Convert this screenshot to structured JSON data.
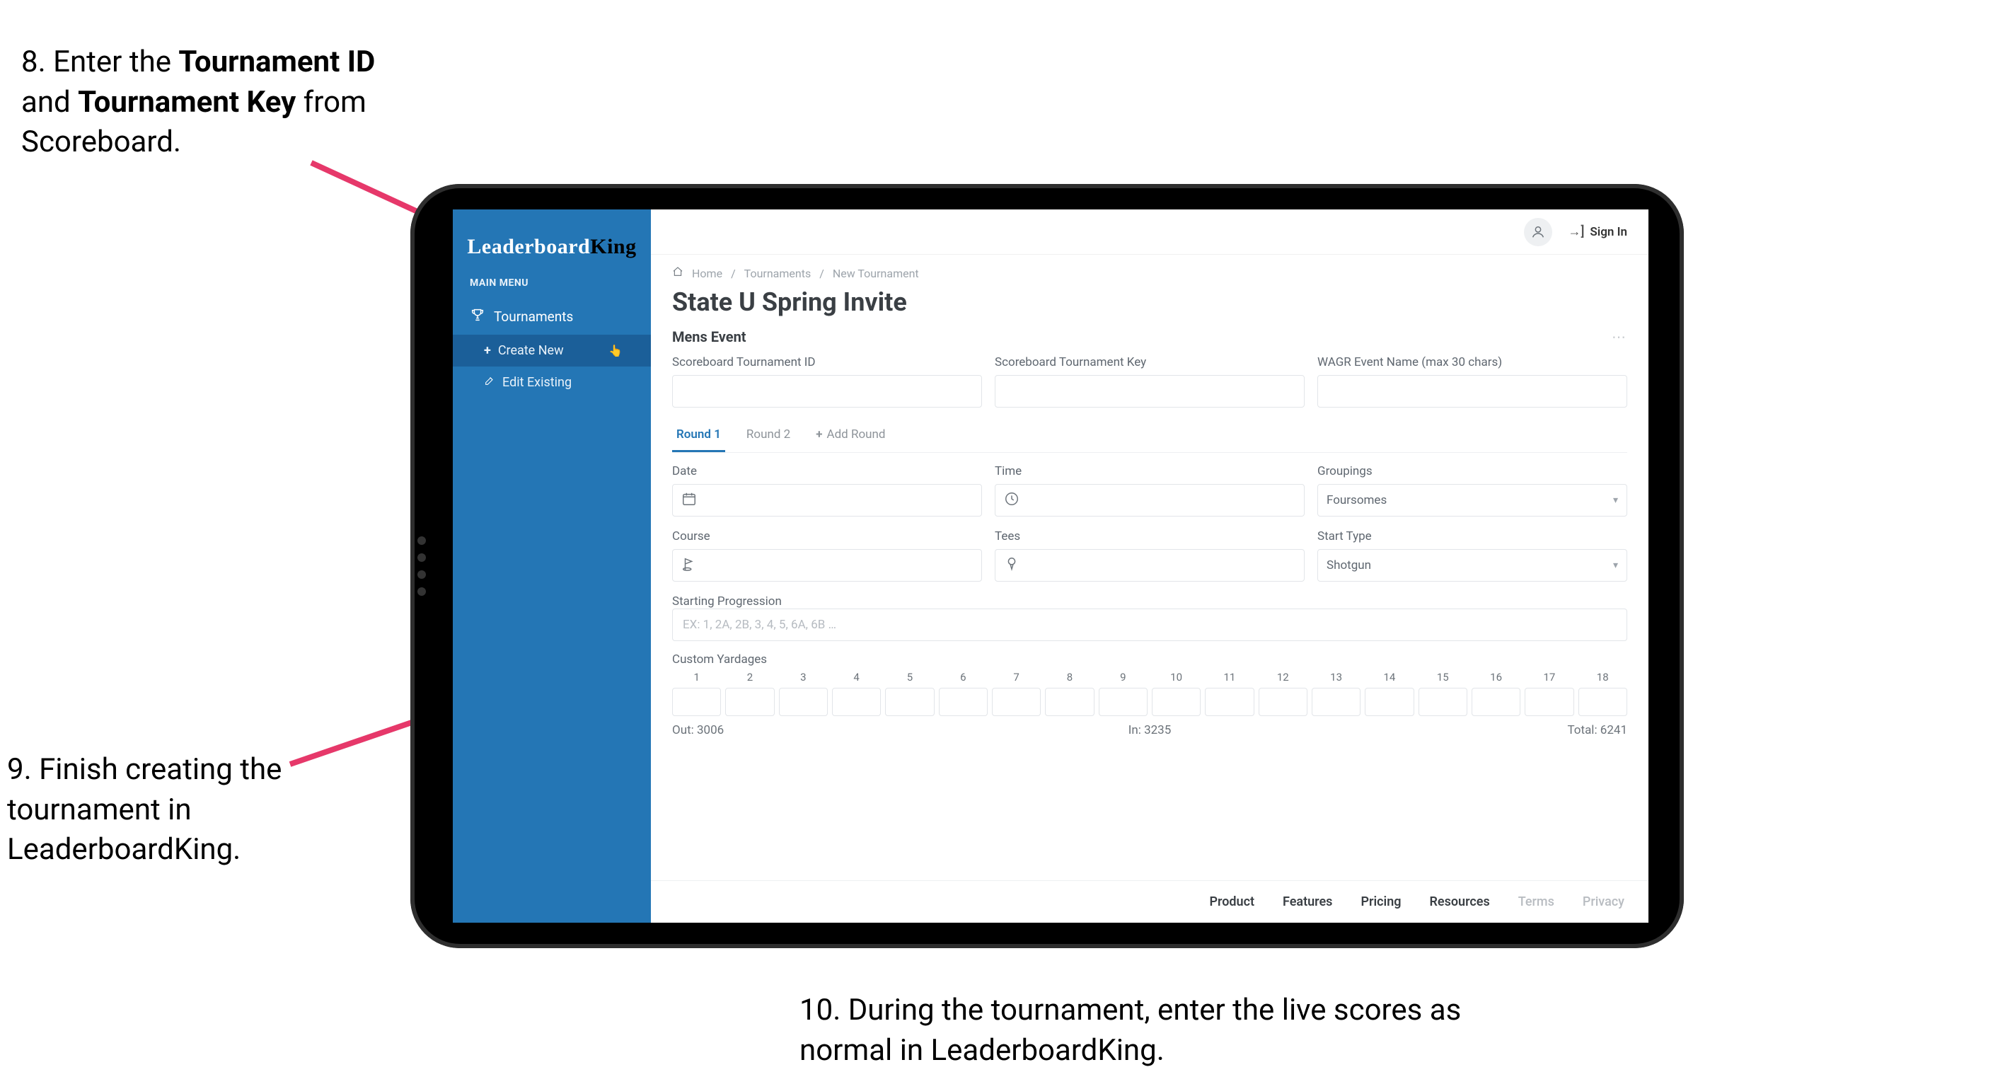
{
  "callouts": {
    "step8": {
      "prefix": "8. Enter the ",
      "bold1": "Tournament ID",
      "mid": " and ",
      "bold2": "Tournament Key",
      "suffix": " from Scoreboard."
    },
    "step9": "9. Finish creating the tournament in LeaderboardKing.",
    "step10": "10. During the tournament, enter the live scores as normal in LeaderboardKing."
  },
  "colors": {
    "arrow": "#e6386a",
    "sidebar": "#2476b5"
  },
  "sidebar": {
    "logo_leaderboard": "Leaderboard",
    "logo_king": "King",
    "main_menu_label": "MAIN MENU",
    "tournaments_label": "Tournaments",
    "create_new_label": "Create New",
    "edit_existing_label": "Edit Existing"
  },
  "topbar": {
    "signin_label": "Sign In"
  },
  "breadcrumb": {
    "home": "Home",
    "tournaments": "Tournaments",
    "new": "New Tournament"
  },
  "page_title": "State U Spring Invite",
  "section_title": "Mens Event",
  "fields": {
    "scoreboard_id_label": "Scoreboard Tournament ID",
    "scoreboard_key_label": "Scoreboard Tournament Key",
    "wagr_label": "WAGR Event Name (max 30 chars)",
    "date_label": "Date",
    "time_label": "Time",
    "groupings_label": "Groupings",
    "groupings_value": "Foursomes",
    "course_label": "Course",
    "tees_label": "Tees",
    "start_type_label": "Start Type",
    "start_type_value": "Shotgun",
    "starting_progression_label": "Starting Progression",
    "starting_progression_placeholder": "EX: 1, 2A, 2B, 3, 4, 5, 6A, 6B …",
    "custom_yardages_label": "Custom Yardages"
  },
  "tabs": {
    "round1": "Round 1",
    "round2": "Round 2",
    "add_round": "Add Round"
  },
  "yardages": {
    "holes": [
      "1",
      "2",
      "3",
      "4",
      "5",
      "6",
      "7",
      "8",
      "9",
      "10",
      "11",
      "12",
      "13",
      "14",
      "15",
      "16",
      "17",
      "18"
    ],
    "out_label": "Out:",
    "out_value": "3006",
    "in_label": "In:",
    "in_value": "3235",
    "total_label": "Total:",
    "total_value": "6241"
  },
  "footer": {
    "product": "Product",
    "features": "Features",
    "pricing": "Pricing",
    "resources": "Resources",
    "terms": "Terms",
    "privacy": "Privacy"
  }
}
